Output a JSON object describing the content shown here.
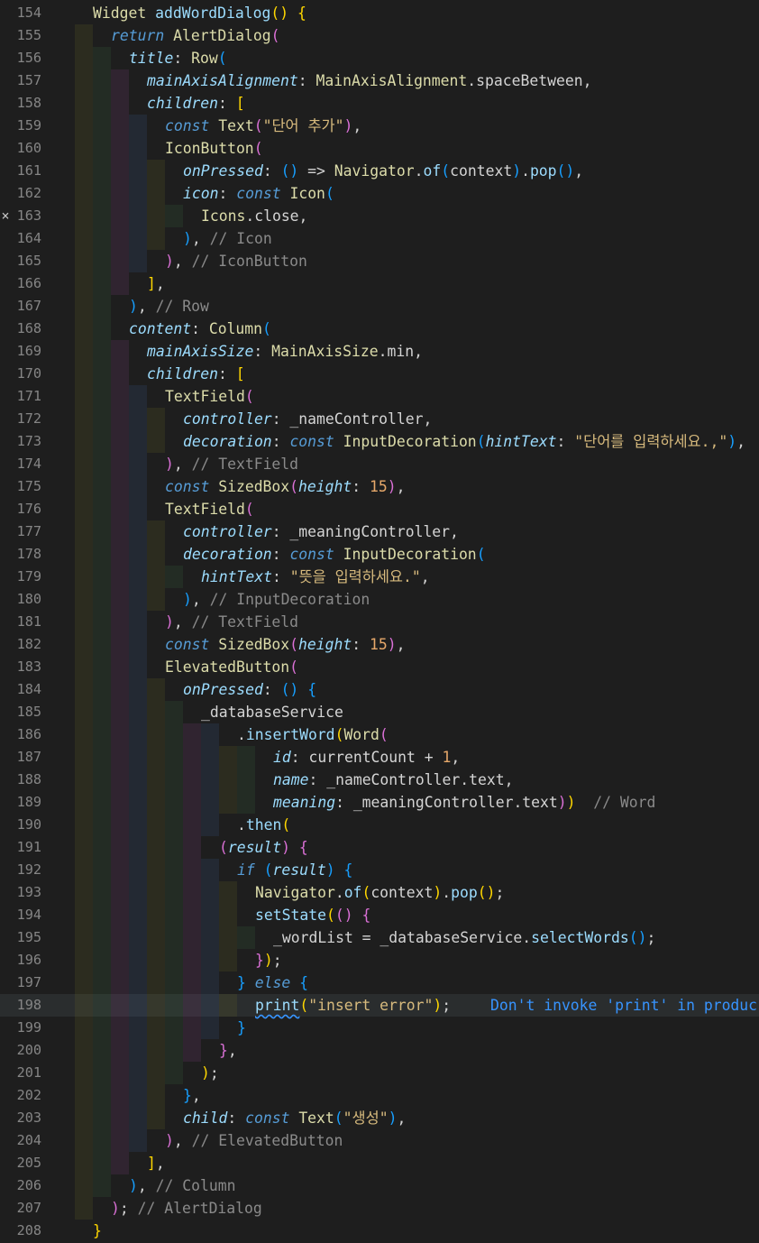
{
  "editor": {
    "language": "dart",
    "active_line": 198,
    "colors": {
      "background": "#1e1e1e",
      "line_number": "#858585",
      "keyword": "#569cd6",
      "type": "#dcdcaa",
      "property": "#9cdcfe",
      "string": "#d7ba7d",
      "number": "#e6a86a",
      "comment": "#8a8a8a",
      "bracket_1": "#ffd700",
      "bracket_2": "#da70d6",
      "bracket_3": "#179fff",
      "diagnostic": "#3794ff"
    },
    "fold_glyph": {
      "line": 163,
      "icon": "close-icon",
      "char": "×"
    },
    "diagnostic": {
      "line": 198,
      "text": "Don't invoke 'print' in produc",
      "underline": "print"
    },
    "lines": [
      {
        "n": "154",
        "lv": 0,
        "t": [
          [
            "type",
            "Widget"
          ],
          [
            "txt",
            " "
          ],
          [
            "func",
            "addWordDialog"
          ],
          [
            "p1",
            "()"
          ],
          [
            "txt",
            " "
          ],
          [
            "p1",
            "{"
          ]
        ]
      },
      {
        "n": "155",
        "lv": 1,
        "t": [
          [
            "kw",
            "return"
          ],
          [
            "txt",
            " "
          ],
          [
            "type",
            "AlertDialog"
          ],
          [
            "p2",
            "("
          ]
        ]
      },
      {
        "n": "156",
        "lv": 2,
        "t": [
          [
            "prop",
            "title"
          ],
          [
            "txt",
            ": "
          ],
          [
            "type",
            "Row"
          ],
          [
            "p3",
            "("
          ]
        ]
      },
      {
        "n": "157",
        "lv": 3,
        "t": [
          [
            "prop",
            "mainAxisAlignment"
          ],
          [
            "txt",
            ": "
          ],
          [
            "type",
            "MainAxisAlignment"
          ],
          [
            "txt",
            ".spaceBetween,"
          ]
        ]
      },
      {
        "n": "158",
        "lv": 3,
        "t": [
          [
            "prop",
            "children"
          ],
          [
            "txt",
            ": "
          ],
          [
            "p1",
            "["
          ]
        ]
      },
      {
        "n": "159",
        "lv": 4,
        "t": [
          [
            "kw",
            "const"
          ],
          [
            "txt",
            " "
          ],
          [
            "type",
            "Text"
          ],
          [
            "p2",
            "("
          ],
          [
            "str",
            "\"단어 추가\""
          ],
          [
            "p2",
            ")"
          ],
          [
            "txt",
            ","
          ]
        ]
      },
      {
        "n": "160",
        "lv": 4,
        "t": [
          [
            "type",
            "IconButton"
          ],
          [
            "p2",
            "("
          ]
        ]
      },
      {
        "n": "161",
        "lv": 5,
        "t": [
          [
            "prop",
            "onPressed"
          ],
          [
            "txt",
            ": "
          ],
          [
            "p3",
            "()"
          ],
          [
            "txt",
            " => "
          ],
          [
            "type",
            "Navigator"
          ],
          [
            "txt",
            "."
          ],
          [
            "func",
            "of"
          ],
          [
            "p3",
            "("
          ],
          [
            "txt",
            "context"
          ],
          [
            "p3",
            ")"
          ],
          [
            "txt",
            "."
          ],
          [
            "func",
            "pop"
          ],
          [
            "p3",
            "()"
          ],
          [
            "txt",
            ","
          ]
        ]
      },
      {
        "n": "162",
        "lv": 5,
        "t": [
          [
            "prop",
            "icon"
          ],
          [
            "txt",
            ": "
          ],
          [
            "kw",
            "const"
          ],
          [
            "txt",
            " "
          ],
          [
            "type",
            "Icon"
          ],
          [
            "p3",
            "("
          ]
        ]
      },
      {
        "n": "163",
        "lv": 6,
        "t": [
          [
            "type",
            "Icons"
          ],
          [
            "txt",
            ".close,"
          ]
        ]
      },
      {
        "n": "164",
        "lv": 5,
        "t": [
          [
            "p3",
            ")"
          ],
          [
            "txt",
            ", "
          ],
          [
            "cmt",
            "// Icon"
          ]
        ]
      },
      {
        "n": "165",
        "lv": 4,
        "t": [
          [
            "p2",
            ")"
          ],
          [
            "txt",
            ", "
          ],
          [
            "cmt",
            "// IconButton"
          ]
        ]
      },
      {
        "n": "166",
        "lv": 3,
        "t": [
          [
            "p1",
            "]"
          ],
          [
            "txt",
            ","
          ]
        ]
      },
      {
        "n": "167",
        "lv": 2,
        "t": [
          [
            "p3",
            ")"
          ],
          [
            "txt",
            ", "
          ],
          [
            "cmt",
            "// Row"
          ]
        ]
      },
      {
        "n": "168",
        "lv": 2,
        "t": [
          [
            "prop",
            "content"
          ],
          [
            "txt",
            ": "
          ],
          [
            "type",
            "Column"
          ],
          [
            "p3",
            "("
          ]
        ]
      },
      {
        "n": "169",
        "lv": 3,
        "t": [
          [
            "prop",
            "mainAxisSize"
          ],
          [
            "txt",
            ": "
          ],
          [
            "type",
            "MainAxisSize"
          ],
          [
            "txt",
            ".min,"
          ]
        ]
      },
      {
        "n": "170",
        "lv": 3,
        "t": [
          [
            "prop",
            "children"
          ],
          [
            "txt",
            ": "
          ],
          [
            "p1",
            "["
          ]
        ]
      },
      {
        "n": "171",
        "lv": 4,
        "t": [
          [
            "type",
            "TextField"
          ],
          [
            "p2",
            "("
          ]
        ]
      },
      {
        "n": "172",
        "lv": 5,
        "t": [
          [
            "prop",
            "controller"
          ],
          [
            "txt",
            ": _nameController,"
          ]
        ]
      },
      {
        "n": "173",
        "lv": 5,
        "t": [
          [
            "prop",
            "decoration"
          ],
          [
            "txt",
            ": "
          ],
          [
            "kw",
            "const"
          ],
          [
            "txt",
            " "
          ],
          [
            "type",
            "InputDecoration"
          ],
          [
            "p3",
            "("
          ],
          [
            "prop",
            "hintText"
          ],
          [
            "txt",
            ": "
          ],
          [
            "str",
            "\"단어를 입력하세요.,\""
          ],
          [
            "p3",
            ")"
          ],
          [
            "txt",
            ","
          ]
        ]
      },
      {
        "n": "174",
        "lv": 4,
        "t": [
          [
            "p2",
            ")"
          ],
          [
            "txt",
            ", "
          ],
          [
            "cmt",
            "// TextField"
          ]
        ]
      },
      {
        "n": "175",
        "lv": 4,
        "t": [
          [
            "kw",
            "const"
          ],
          [
            "txt",
            " "
          ],
          [
            "type",
            "SizedBox"
          ],
          [
            "p2",
            "("
          ],
          [
            "prop",
            "height"
          ],
          [
            "txt",
            ": "
          ],
          [
            "num",
            "15"
          ],
          [
            "p2",
            ")"
          ],
          [
            "txt",
            ","
          ]
        ]
      },
      {
        "n": "176",
        "lv": 4,
        "t": [
          [
            "type",
            "TextField"
          ],
          [
            "p2",
            "("
          ]
        ]
      },
      {
        "n": "177",
        "lv": 5,
        "t": [
          [
            "prop",
            "controller"
          ],
          [
            "txt",
            ": _meaningController,"
          ]
        ]
      },
      {
        "n": "178",
        "lv": 5,
        "t": [
          [
            "prop",
            "decoration"
          ],
          [
            "txt",
            ": "
          ],
          [
            "kw",
            "const"
          ],
          [
            "txt",
            " "
          ],
          [
            "type",
            "InputDecoration"
          ],
          [
            "p3",
            "("
          ]
        ]
      },
      {
        "n": "179",
        "lv": 6,
        "t": [
          [
            "prop",
            "hintText"
          ],
          [
            "txt",
            ": "
          ],
          [
            "str",
            "\"뜻을 입력하세요.\""
          ],
          [
            "txt",
            ","
          ]
        ]
      },
      {
        "n": "180",
        "lv": 5,
        "t": [
          [
            "p3",
            ")"
          ],
          [
            "txt",
            ", "
          ],
          [
            "cmt",
            "// InputDecoration"
          ]
        ]
      },
      {
        "n": "181",
        "lv": 4,
        "t": [
          [
            "p2",
            ")"
          ],
          [
            "txt",
            ", "
          ],
          [
            "cmt",
            "// TextField"
          ]
        ]
      },
      {
        "n": "182",
        "lv": 4,
        "t": [
          [
            "kw",
            "const"
          ],
          [
            "txt",
            " "
          ],
          [
            "type",
            "SizedBox"
          ],
          [
            "p2",
            "("
          ],
          [
            "prop",
            "height"
          ],
          [
            "txt",
            ": "
          ],
          [
            "num",
            "15"
          ],
          [
            "p2",
            ")"
          ],
          [
            "txt",
            ","
          ]
        ]
      },
      {
        "n": "183",
        "lv": 4,
        "t": [
          [
            "type",
            "ElevatedButton"
          ],
          [
            "p2",
            "("
          ]
        ]
      },
      {
        "n": "184",
        "lv": 5,
        "t": [
          [
            "prop",
            "onPressed"
          ],
          [
            "txt",
            ": "
          ],
          [
            "p3",
            "()"
          ],
          [
            "txt",
            " "
          ],
          [
            "p3",
            "{"
          ]
        ]
      },
      {
        "n": "185",
        "lv": 6,
        "t": [
          [
            "txt",
            "_databaseService"
          ]
        ]
      },
      {
        "n": "186",
        "lv": 8,
        "t": [
          [
            "txt",
            "."
          ],
          [
            "func",
            "insertWord"
          ],
          [
            "p1",
            "("
          ],
          [
            "type",
            "Word"
          ],
          [
            "p2",
            "("
          ]
        ]
      },
      {
        "n": "187",
        "lv": 10,
        "t": [
          [
            "prop",
            "id"
          ],
          [
            "txt",
            ": currentCount + "
          ],
          [
            "num",
            "1"
          ],
          [
            "txt",
            ","
          ]
        ]
      },
      {
        "n": "188",
        "lv": 10,
        "t": [
          [
            "prop",
            "name"
          ],
          [
            "txt",
            ": _nameController.text,"
          ]
        ]
      },
      {
        "n": "189",
        "lv": 10,
        "t": [
          [
            "prop",
            "meaning"
          ],
          [
            "txt",
            ": _meaningController.text"
          ],
          [
            "p2",
            ")"
          ],
          [
            "p1",
            ")"
          ],
          [
            "txt",
            "  "
          ],
          [
            "cmt",
            "// Word"
          ]
        ]
      },
      {
        "n": "190",
        "lv": 8,
        "t": [
          [
            "txt",
            "."
          ],
          [
            "func",
            "then"
          ],
          [
            "p1",
            "("
          ]
        ]
      },
      {
        "n": "191",
        "lv": 7,
        "t": [
          [
            "p2",
            "("
          ],
          [
            "prop",
            "result"
          ],
          [
            "p2",
            ")"
          ],
          [
            "txt",
            " "
          ],
          [
            "p2",
            "{"
          ]
        ]
      },
      {
        "n": "192",
        "lv": 8,
        "t": [
          [
            "kw",
            "if"
          ],
          [
            "txt",
            " "
          ],
          [
            "p3",
            "("
          ],
          [
            "prop",
            "result"
          ],
          [
            "p3",
            ")"
          ],
          [
            "txt",
            " "
          ],
          [
            "p3",
            "{"
          ]
        ]
      },
      {
        "n": "193",
        "lv": 9,
        "t": [
          [
            "type",
            "Navigator"
          ],
          [
            "txt",
            "."
          ],
          [
            "func",
            "of"
          ],
          [
            "p1",
            "("
          ],
          [
            "txt",
            "context"
          ],
          [
            "p1",
            ")"
          ],
          [
            "txt",
            "."
          ],
          [
            "func",
            "pop"
          ],
          [
            "p1",
            "()"
          ],
          [
            "txt",
            ";"
          ]
        ]
      },
      {
        "n": "194",
        "lv": 9,
        "t": [
          [
            "func",
            "setState"
          ],
          [
            "p1",
            "("
          ],
          [
            "p2",
            "()"
          ],
          [
            "txt",
            " "
          ],
          [
            "p2",
            "{"
          ]
        ]
      },
      {
        "n": "195",
        "lv": 10,
        "t": [
          [
            "txt",
            "_wordList = _databaseService."
          ],
          [
            "func",
            "selectWords"
          ],
          [
            "p3",
            "()"
          ],
          [
            "txt",
            ";"
          ]
        ]
      },
      {
        "n": "196",
        "lv": 9,
        "t": [
          [
            "p2",
            "}"
          ],
          [
            "p1",
            ")"
          ],
          [
            "txt",
            ";"
          ]
        ]
      },
      {
        "n": "197",
        "lv": 8,
        "t": [
          [
            "p3",
            "}"
          ],
          [
            "txt",
            " "
          ],
          [
            "kw",
            "else"
          ],
          [
            "txt",
            " "
          ],
          [
            "p3",
            "{"
          ]
        ]
      },
      {
        "n": "198",
        "lv": 9,
        "t": [
          [
            "func",
            "print",
            "squiggle"
          ],
          [
            "p1",
            "("
          ],
          [
            "str",
            "\"insert error\""
          ],
          [
            "p1",
            ")"
          ],
          [
            "txt",
            ";"
          ]
        ]
      },
      {
        "n": "199",
        "lv": 8,
        "t": [
          [
            "p3",
            "}"
          ]
        ]
      },
      {
        "n": "200",
        "lv": 7,
        "t": [
          [
            "p2",
            "}"
          ],
          [
            "txt",
            ","
          ]
        ]
      },
      {
        "n": "201",
        "lv": 6,
        "t": [
          [
            "p1",
            ")"
          ],
          [
            "txt",
            ";"
          ]
        ]
      },
      {
        "n": "202",
        "lv": 5,
        "t": [
          [
            "p3",
            "}"
          ],
          [
            "txt",
            ","
          ]
        ]
      },
      {
        "n": "203",
        "lv": 5,
        "t": [
          [
            "prop",
            "child"
          ],
          [
            "txt",
            ": "
          ],
          [
            "kw",
            "const"
          ],
          [
            "txt",
            " "
          ],
          [
            "type",
            "Text"
          ],
          [
            "p3",
            "("
          ],
          [
            "str",
            "\"생성\""
          ],
          [
            "p3",
            ")"
          ],
          [
            "txt",
            ","
          ]
        ]
      },
      {
        "n": "204",
        "lv": 4,
        "t": [
          [
            "p2",
            ")"
          ],
          [
            "txt",
            ", "
          ],
          [
            "cmt",
            "// ElevatedButton"
          ]
        ]
      },
      {
        "n": "205",
        "lv": 3,
        "t": [
          [
            "p1",
            "]"
          ],
          [
            "txt",
            ","
          ]
        ]
      },
      {
        "n": "206",
        "lv": 2,
        "t": [
          [
            "p3",
            ")"
          ],
          [
            "txt",
            ", "
          ],
          [
            "cmt",
            "// Column"
          ]
        ]
      },
      {
        "n": "207",
        "lv": 1,
        "t": [
          [
            "p2",
            ")"
          ],
          [
            "txt",
            "; "
          ],
          [
            "cmt",
            "// AlertDialog"
          ]
        ]
      },
      {
        "n": "208",
        "lv": 0,
        "t": [
          [
            "p1",
            "}"
          ]
        ]
      }
    ]
  }
}
